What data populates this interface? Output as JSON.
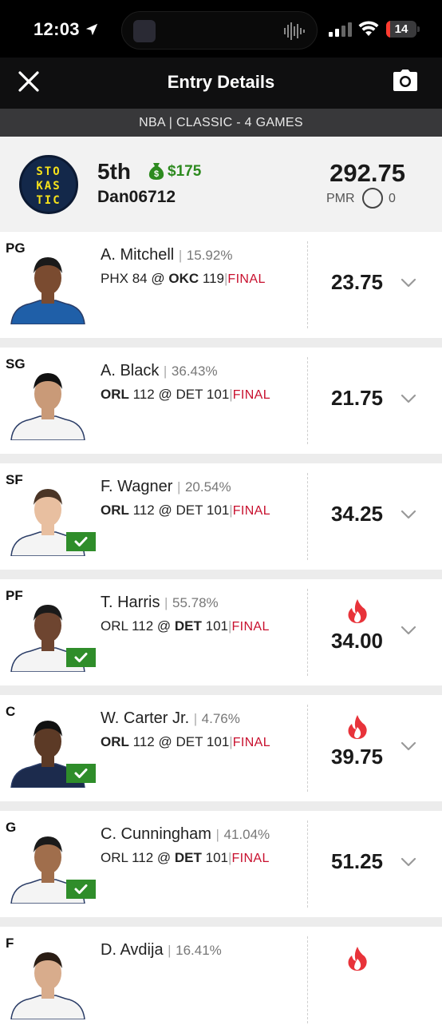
{
  "status_bar": {
    "time": "12:03",
    "battery": "14",
    "battery_level": 0.14,
    "battery_color": "#ff3b30"
  },
  "nav": {
    "title": "Entry Details",
    "close_icon": "close-icon",
    "camera_icon": "camera-icon"
  },
  "contest": {
    "label": "NBA | CLASSIC - 4 GAMES"
  },
  "entry": {
    "logo_lines": [
      "STO",
      "KAS",
      "TIC"
    ],
    "rank": "5th",
    "prize": "$175",
    "username": "Dan06712",
    "total_points": "292.75",
    "pmr_label": "PMR",
    "pmr_value": "0"
  },
  "colors": {
    "accent_green": "#2d8a1f",
    "final_red": "#c8102e",
    "check_green": "#2f8d2a",
    "flame": "#e8333a"
  },
  "players": [
    {
      "pos": "PG",
      "name": "A. Mitchell",
      "own_sep": "|",
      "ownership": "15.92%",
      "away": "PHX",
      "away_score": "84",
      "at": "@",
      "home": "OKC",
      "home_score": "119",
      "bold": "home",
      "game_sep": "|",
      "status": "FINAL",
      "points": "23.75",
      "hot": false,
      "checked": false,
      "jersey": "#1f5fa8",
      "skin": "#7a4b30",
      "hair": "#1a1a1a"
    },
    {
      "pos": "SG",
      "name": "A. Black",
      "own_sep": "|",
      "ownership": "36.43%",
      "away": "ORL",
      "away_score": "112",
      "at": "@",
      "home": "DET",
      "home_score": "101",
      "bold": "away",
      "game_sep": "|",
      "status": "FINAL",
      "points": "21.75",
      "hot": false,
      "checked": false,
      "jersey": "#f4f4f4",
      "skin": "#c99a78",
      "hair": "#111111"
    },
    {
      "pos": "SF",
      "name": "F. Wagner",
      "own_sep": "|",
      "ownership": "20.54%",
      "away": "ORL",
      "away_score": "112",
      "at": "@",
      "home": "DET",
      "home_score": "101",
      "bold": "away",
      "game_sep": "|",
      "status": "FINAL",
      "points": "34.25",
      "hot": false,
      "checked": true,
      "jersey": "#f4f4f4",
      "skin": "#e8bfa0",
      "hair": "#4a3526"
    },
    {
      "pos": "PF",
      "name": "T. Harris",
      "own_sep": "|",
      "ownership": "55.78%",
      "away": "ORL",
      "away_score": "112",
      "at": "@",
      "home": "DET",
      "home_score": "101",
      "bold": "home",
      "game_sep": "|",
      "status": "FINAL",
      "points": "34.00",
      "hot": true,
      "checked": true,
      "jersey": "#f4f4f4",
      "skin": "#6e4530",
      "hair": "#1a1a1a"
    },
    {
      "pos": "C",
      "name": "W. Carter Jr.",
      "own_sep": "|",
      "ownership": "4.76%",
      "away": "ORL",
      "away_score": "112",
      "at": "@",
      "home": "DET",
      "home_score": "101",
      "bold": "away",
      "game_sep": "|",
      "status": "FINAL",
      "points": "39.75",
      "hot": true,
      "checked": true,
      "jersey": "#1c2b4d",
      "skin": "#5c3a26",
      "hair": "#111111"
    },
    {
      "pos": "G",
      "name": "C. Cunningham",
      "own_sep": "|",
      "ownership": "41.04%",
      "away": "ORL",
      "away_score": "112",
      "at": "@",
      "home": "DET",
      "home_score": "101",
      "bold": "home",
      "game_sep": "|",
      "status": "FINAL",
      "points": "51.25",
      "hot": false,
      "checked": true,
      "jersey": "#f4f4f4",
      "skin": "#a06e4c",
      "hair": "#1a1a1a"
    },
    {
      "pos": "F",
      "name": "D. Avdija",
      "own_sep": "|",
      "ownership": "16.41%",
      "away": "",
      "away_score": "",
      "at": "",
      "home": "",
      "home_score": "",
      "bold": "",
      "game_sep": "",
      "status": "",
      "points": "",
      "hot": true,
      "checked": false,
      "jersey": "#f4f4f4",
      "skin": "#d8ac8c",
      "hair": "#2a1d14"
    }
  ]
}
